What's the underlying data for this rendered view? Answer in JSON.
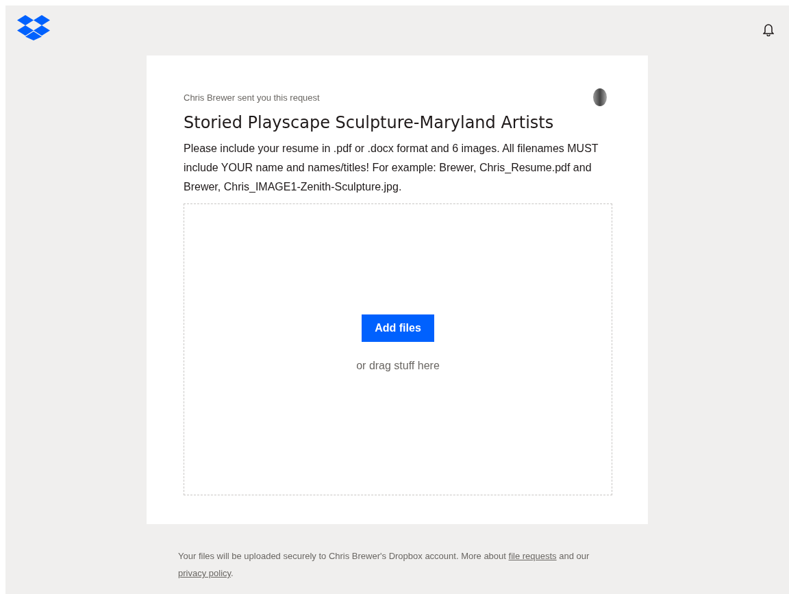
{
  "request": {
    "sender": "Chris Brewer sent you this request",
    "title": "Storied Playscape Sculpture-Maryland Artists",
    "description": "Please include your resume in .pdf or .docx format and 6 images. All filenames MUST include YOUR name and names/titles! For example: Brewer, Chris_Resume.pdf and Brewer, Chris_IMAGE1-Zenith-Sculpture.jpg."
  },
  "dropzone": {
    "button": "Add files",
    "hint": "or drag stuff here"
  },
  "footer": {
    "text": "Your files will be uploaded securely to Chris Brewer's Dropbox account. More about ",
    "link_1": "file requests",
    "middle": " and our ",
    "link_2": "privacy policy",
    "end": "."
  }
}
